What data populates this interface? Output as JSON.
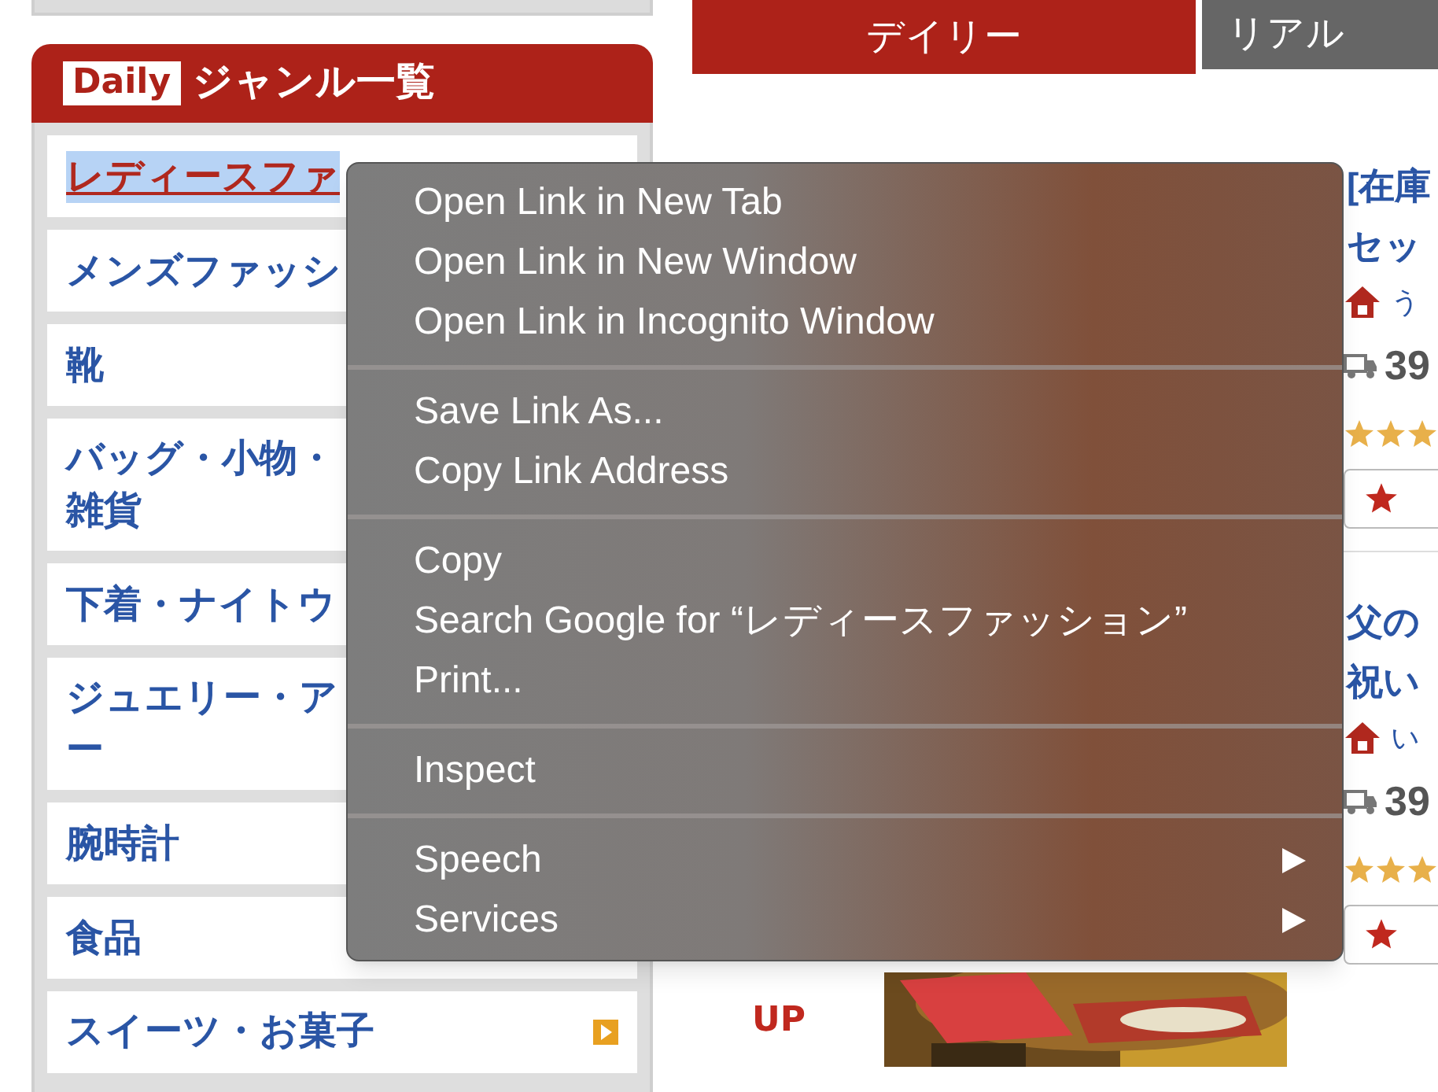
{
  "sidebar": {
    "badge": "Daily",
    "title": "ジャンル一覧",
    "items": [
      {
        "lines": [
          "レディースファ"
        ],
        "selected": true
      },
      {
        "lines": [
          "メンズファッシ"
        ],
        "selected": false
      },
      {
        "lines": [
          "靴"
        ],
        "selected": false
      },
      {
        "lines": [
          "バッグ・小物・",
          "雑貨"
        ],
        "selected": false
      },
      {
        "lines": [
          "下着・ナイトウ"
        ],
        "selected": false
      },
      {
        "lines": [
          "ジュエリー・ア",
          "ー"
        ],
        "selected": false
      },
      {
        "lines": [
          "腕時計"
        ],
        "selected": false
      },
      {
        "lines": [
          "食品"
        ],
        "selected": false
      },
      {
        "lines": [
          "スイーツ・お菓子"
        ],
        "selected": false
      }
    ]
  },
  "tabs": [
    {
      "label": "デイリー",
      "selected": true
    },
    {
      "label": "リアル",
      "selected": false
    }
  ],
  "products": [
    {
      "title": [
        "[在庫",
        "セッ"
      ],
      "shop": "う",
      "shipping": "39"
    },
    {
      "title": [
        "父の",
        "祝い"
      ],
      "shop": "い",
      "shipping": "39"
    }
  ],
  "rank_change": "UP",
  "context_menu": {
    "groups": [
      [
        {
          "label": "Open Link in New Tab"
        },
        {
          "label": "Open Link in New Window"
        },
        {
          "label": "Open Link in Incognito Window"
        }
      ],
      [
        {
          "label": "Save Link As..."
        },
        {
          "label": "Copy Link Address"
        }
      ],
      [
        {
          "label": "Copy"
        },
        {
          "label": "Search Google for “レディースファッション”"
        },
        {
          "label": "Print..."
        }
      ],
      [
        {
          "label": "Inspect"
        }
      ],
      [
        {
          "label": "Speech",
          "submenu": true
        },
        {
          "label": "Services",
          "submenu": true
        }
      ]
    ]
  }
}
